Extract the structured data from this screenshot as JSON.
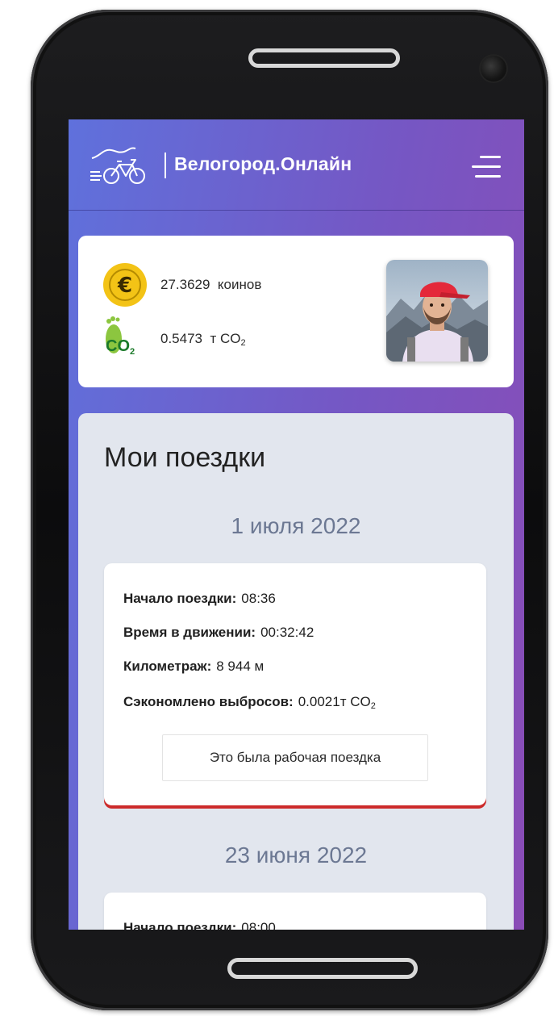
{
  "app": {
    "title": "Велогород.Онлайн"
  },
  "stats": {
    "coins_value": "27.3629",
    "coins_unit": "коинов",
    "co2_value": "0.5473",
    "co2_unit": "т CO",
    "co2_sub": "2"
  },
  "trips": {
    "title": "Мои поездки",
    "groups": [
      {
        "date": "1 июля 2022",
        "start_label": "Начало поездки:",
        "start_value": "08:36",
        "moving_label": "Время в движении:",
        "moving_value": "00:32:42",
        "distance_label": "Километраж:",
        "distance_value": "8 944 м",
        "saved_label": "Сэкономлено выбросов:",
        "saved_value": "0.0021т CO",
        "saved_sub": "2",
        "work_button": "Это была рабочая поездка"
      },
      {
        "date": "23 июня 2022",
        "start_label": "Начало поездки:",
        "start_value": "08:00"
      }
    ]
  },
  "colors": {
    "gradient_start": "#5f71dc",
    "gradient_end": "#8a4cb6",
    "coin": "#f3c316",
    "co2_green": "#2f9a37",
    "accent_red": "#cc2a2a",
    "date_text": "#6c7893"
  },
  "icons": {
    "logo": "bicycle-logo-icon",
    "menu": "hamburger-menu-icon",
    "coin": "euro-coin-icon",
    "co2": "footprint-co2-icon"
  }
}
